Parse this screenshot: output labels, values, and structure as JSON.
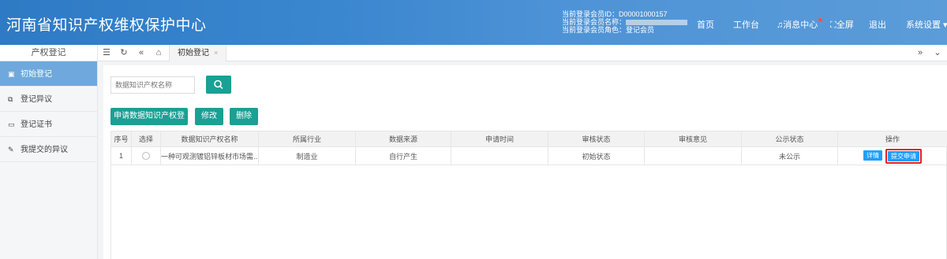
{
  "header": {
    "title": "河南省知识产权维权保护中心",
    "user_id": "当前登录会员ID：D00001000157",
    "user_name_label": "当前登录会员名称：",
    "user_role": "当前登录会员角色：登记会员",
    "nav": {
      "home": "首页",
      "workbench": "工作台",
      "messages": "消息中心",
      "fullscreen": "全屏",
      "logout": "退出",
      "settings": "系统设置"
    }
  },
  "sidebar": {
    "title": "产权登记",
    "items": [
      {
        "label": "初始登记",
        "icon": "register-icon",
        "glyph": "▣",
        "active": true
      },
      {
        "label": "登记异议",
        "icon": "objection-icon",
        "glyph": "⧉",
        "active": false
      },
      {
        "label": "登记证书",
        "icon": "certificate-icon",
        "glyph": "▭",
        "active": false
      },
      {
        "label": "我提交的异议",
        "icon": "edit-icon",
        "glyph": "✎",
        "active": false
      }
    ]
  },
  "tabbar": {
    "active_tab": "初始登记",
    "close": "×"
  },
  "search": {
    "placeholder": "数据知识产权名称"
  },
  "toolbar": {
    "apply": "申请数据知识产权登记",
    "edit": "修改",
    "delete": "删除"
  },
  "table": {
    "headers": [
      "序号",
      "选择",
      "数据知识产权名称",
      "所属行业",
      "数据来源",
      "申请时间",
      "审核状态",
      "审核意见",
      "公示状态",
      "操作"
    ],
    "rows": [
      {
        "index": "1",
        "name": "一种可观测镀铝锌板材市场需...",
        "industry": "制造业",
        "source": "自行产生",
        "apply_time": "",
        "review_status": "初始状态",
        "review_opinion": "",
        "publicity_status": "未公示",
        "detail": "详情",
        "submit": "提交申请"
      }
    ]
  },
  "colors": {
    "header": "#3a86cf",
    "primary_green": "#1aa094",
    "op_blue": "#1e9fff",
    "highlight_red": "#e0212a",
    "sidebar_active": "#6fa8dc"
  }
}
